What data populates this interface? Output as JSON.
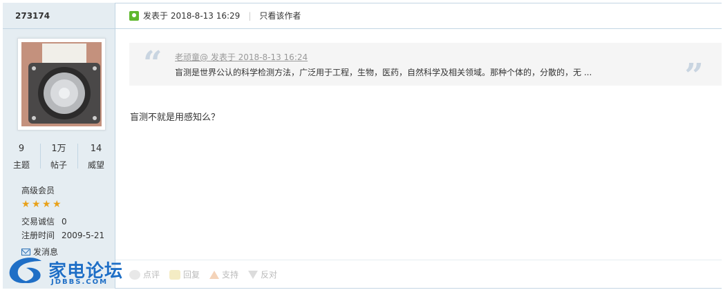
{
  "user": {
    "name": "273174",
    "stats": [
      {
        "num": "9",
        "label": "主题"
      },
      {
        "num": "1万",
        "label": "帖子"
      },
      {
        "num": "14",
        "label": "威望"
      }
    ],
    "group": "高级会员",
    "star_count": 4,
    "trust_label": "交易诚信",
    "trust_value": "0",
    "reg_label": "注册时间",
    "reg_value": "2009-5-21",
    "send_message": "发消息"
  },
  "post": {
    "posted_at": "发表于 2018-8-13 16:29",
    "only_author": "只看该作者",
    "quote": {
      "header": "老顽童@ 发表于 2018-8-13 16:24",
      "body": "盲测是世界公认的科学检测方法，广泛用于工程，生物，医药，自然科学及相关领域。那种个体的，分散的，无 ..."
    },
    "content": "盲测不就是用感知么？",
    "actions": [
      {
        "label": "点评",
        "icon": "comment-icon"
      },
      {
        "label": "回复",
        "icon": "reply-icon"
      },
      {
        "label": "支持",
        "icon": "thumb-up-icon"
      },
      {
        "label": "反对",
        "icon": "thumb-down-icon"
      }
    ]
  },
  "logo": {
    "text": "家电论坛",
    "sub": "JDBBS.COM"
  }
}
